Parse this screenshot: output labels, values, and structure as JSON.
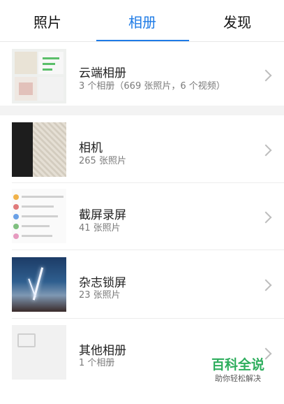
{
  "tabs": [
    {
      "label": "照片"
    },
    {
      "label": "相册"
    },
    {
      "label": "发现"
    }
  ],
  "active_tab_color": "#1e7be6",
  "cloud": {
    "title": "云端相册",
    "subtitle": "3 个相册（669 张照片，6 个视频）"
  },
  "albums": [
    {
      "title": "相机",
      "subtitle": "265 张照片",
      "thumb": "camera-photo"
    },
    {
      "title": "截屏录屏",
      "subtitle": "41 张照片",
      "thumb": "screenshot-list"
    },
    {
      "title": "杂志锁屏",
      "subtitle": "23 张照片",
      "thumb": "lightning-sky"
    },
    {
      "title": "其他相册",
      "subtitle": "1 个相册",
      "thumb": "image-placeholder-icon"
    }
  ],
  "watermark": {
    "main": "百科全说",
    "sub": "助你轻松解决"
  }
}
